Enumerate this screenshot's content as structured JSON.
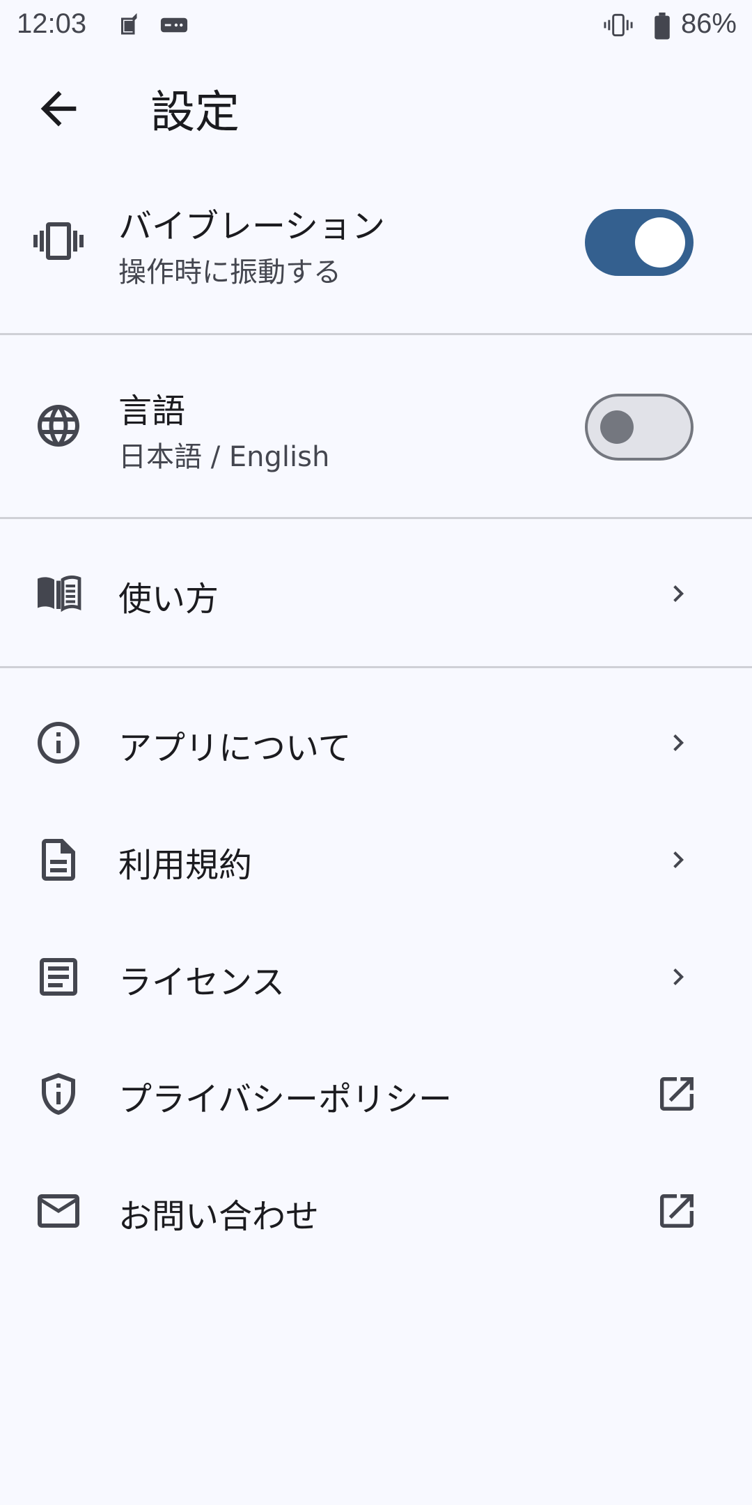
{
  "status_bar": {
    "time": "12:03",
    "battery": "86%",
    "icons": [
      "app-notification-icon",
      "game-controller-icon",
      "vibrate-icon",
      "battery-icon"
    ]
  },
  "app_bar": {
    "title": "設定",
    "back_icon": "arrow-back-icon"
  },
  "settings": {
    "vibration": {
      "title": "バイブレーション",
      "subtitle": "操作時に振動する",
      "enabled": true,
      "icon": "vibration-icon"
    },
    "language": {
      "title": "言語",
      "subtitle": "日本語 / English",
      "enabled": false,
      "icon": "globe-icon"
    },
    "how_to_use": {
      "title": "使い方",
      "icon": "book-icon"
    },
    "about": {
      "title": "アプリについて",
      "icon": "info-icon"
    },
    "terms": {
      "title": "利用規約",
      "icon": "document-icon"
    },
    "license": {
      "title": "ライセンス",
      "icon": "article-icon"
    },
    "privacy": {
      "title": "プライバシーポリシー",
      "icon": "shield-info-icon"
    },
    "contact": {
      "title": "お問い合わせ",
      "icon": "mail-icon"
    }
  },
  "colors": {
    "background": "#f8f9ff",
    "accent": "#34608f",
    "text": "#1b1b1f",
    "subtext": "#44464f",
    "divider": "#cfd0d6"
  }
}
